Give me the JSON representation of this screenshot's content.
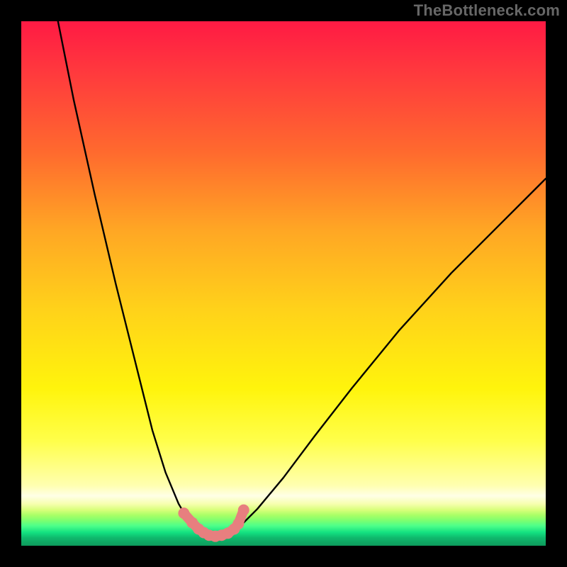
{
  "watermark": "TheBottleneck.com",
  "chart_data": {
    "type": "line",
    "title": "",
    "xlabel": "",
    "ylabel": "",
    "xlim": [
      0,
      100
    ],
    "ylim": [
      0,
      100
    ],
    "grid": false,
    "series": [
      {
        "name": "left-branch",
        "x": [
          7,
          10,
          14,
          18,
          22,
          25,
          27.5,
          30,
          32,
          33.5,
          35,
          36
        ],
        "y": [
          100,
          85,
          67,
          50,
          34,
          22,
          14,
          8,
          4.6,
          3.0,
          2.2,
          1.8
        ]
      },
      {
        "name": "right-branch",
        "x": [
          36,
          37.5,
          39.5,
          42,
          45,
          50,
          56,
          63,
          72,
          82,
          92,
          100
        ],
        "y": [
          1.8,
          2.0,
          2.6,
          4.0,
          7,
          13,
          21,
          30,
          41,
          52,
          62,
          70
        ]
      },
      {
        "name": "highlight-dots",
        "x": [
          31.0,
          32.6,
          33.8,
          34.8,
          35.8,
          37.0,
          38.2,
          39.4,
          40.6,
          41.4,
          42.4
        ],
        "y": [
          6.2,
          4.4,
          3.2,
          2.5,
          2.0,
          1.8,
          2.0,
          2.4,
          3.2,
          4.2,
          6.8
        ]
      }
    ],
    "colors": {
      "curve": "#000000",
      "highlight": "#e77f7f"
    }
  }
}
